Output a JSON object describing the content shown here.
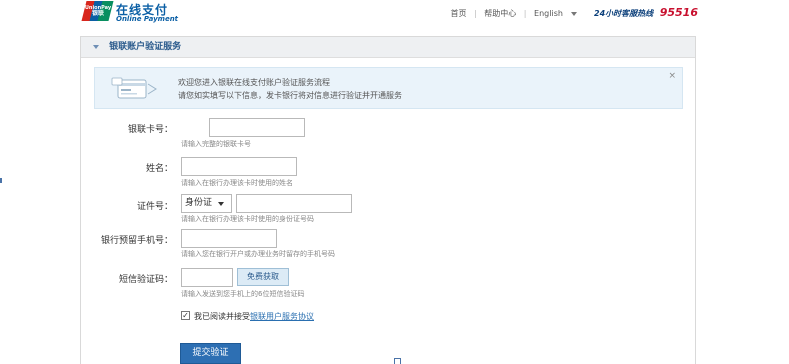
{
  "header": {
    "logo": {
      "text_en": "UnionPay",
      "text_cn": "银联"
    },
    "brand_cn": "在线支付",
    "brand_en": "Online Payment",
    "nav": {
      "home": "首页",
      "help": "帮助中心",
      "language": "English"
    },
    "hotline_label": "24小时客服热线",
    "hotline_number": "95516"
  },
  "panel": {
    "title": "银联账户验证服务",
    "notice": {
      "line1": "欢迎您进入银联在线支付账户验证服务流程",
      "line2": "请您如实填写以下信息，发卡银行将对信息进行验证并开通服务",
      "close": "×"
    }
  },
  "form": {
    "card": {
      "label": "银联卡号：",
      "value": "",
      "hint": "请输入完整的银联卡号"
    },
    "name": {
      "label": "姓名：",
      "value": "",
      "hint": "请输入在银行办理该卡时使用的姓名"
    },
    "id": {
      "label": "证件号：",
      "type_selected": "身份证",
      "value": "",
      "hint": "请输入在银行办理该卡时使用的身份证号码"
    },
    "phone": {
      "label": "银行预留手机号：",
      "value": "",
      "hint": "请输入您在银行开户或办理业务时留存的手机号码"
    },
    "sms": {
      "label": "短信验证码：",
      "value": "",
      "button": "免费获取",
      "hint": "请输入发送到您手机上的6位短信验证码"
    },
    "agree": {
      "checked": true,
      "text": "我已阅读并接受",
      "link": "银联用户服务协议"
    },
    "submit": "提交验证"
  },
  "colors": {
    "brand_blue": "#0b5fa5",
    "brand_red": "#d8261c",
    "brand_green": "#098f60",
    "hotline_red": "#c8102e",
    "submit_blue": "#2d6fb3"
  }
}
